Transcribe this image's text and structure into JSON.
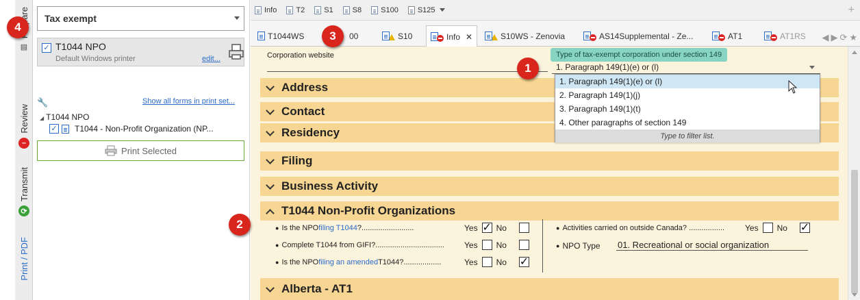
{
  "sidebar_tabs": {
    "prepare": "Prepare",
    "review": "Review",
    "transmit": "Transmit",
    "print_pdf": "Print / PDF"
  },
  "print_panel": {
    "print_set_selected": "Tax exempt",
    "printer_name": "T1044 NPO",
    "printer_desc": "Default Windows printer",
    "edit_link": "edit...",
    "show_all_link": "Show all forms in print set...",
    "tree_root": "T1044 NPO",
    "tree_item": "T1044 - Non-Profit Organization (NP...",
    "print_selected_button": "Print Selected"
  },
  "top_tabs": [
    "Info",
    "T2",
    "S1",
    "S8",
    "S100",
    "S125"
  ],
  "doc_tabs": {
    "t1044ws": "T1044WS",
    "s100_partial": "00",
    "s10": "S10",
    "info": "Info",
    "s10ws": "S10WS - Zenovia",
    "as14": "AS14Supplemental - Ze...",
    "at1": "AT1",
    "at1rs": "AT1RS"
  },
  "form": {
    "website_label": "Corporation website",
    "tooltip": "Type of tax-exempt corporation under section 149",
    "dropdown_value": "1. Paragraph 149(1)(e) or (l)",
    "dropdown_options": [
      "1. Paragraph 149(1)(e) or (l)",
      "2. Paragraph 149(1)(j)",
      "3. Paragraph 149(1)(t)",
      "4. Other paragraphs of section 149"
    ],
    "filter_hint": "Type to filter list.",
    "sections": {
      "address": "Address",
      "contact": "Contact",
      "residency": "Residency",
      "filing": "Filing",
      "business": "Business Activity",
      "t1044": "T1044 Non-Profit Organizations",
      "alberta": "Alberta - AT1"
    },
    "q1_pre": "Is the NPO ",
    "q1_link": "filing T1044",
    "q1_post": "?.........................",
    "q2": "Complete T1044 from GIFI?.................................",
    "q3_pre": "Is the NPO ",
    "q3_link": "filing an amended",
    "q3_post": " T1044?..................",
    "q4": "Activities carried on outside Canada? .................",
    "npo_type_label": "NPO Type",
    "npo_type_value": "01. Recreational or social organization",
    "yes": "Yes",
    "no": "No",
    "answers": {
      "q1": "yes",
      "q2": "none",
      "q3": "no",
      "q4": "no"
    }
  },
  "callouts": [
    "1",
    "2",
    "3",
    "4"
  ],
  "colors": {
    "accent_blue": "#2a6cc7",
    "section_bg": "#f7d592",
    "form_bg": "#fcf3dc",
    "tooltip_bg": "#86d4c1",
    "callout_red": "#d9261c"
  }
}
